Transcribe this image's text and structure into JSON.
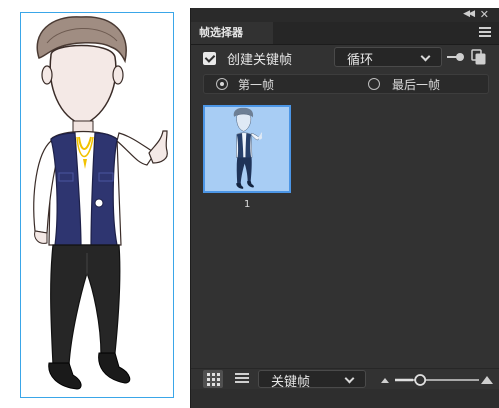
{
  "panel": {
    "title": "帧选择器",
    "collapse_icon": "double-chevron-right-icon",
    "close_icon": "close-icon",
    "menu_icon": "hamburger-menu-icon"
  },
  "toolbar": {
    "create_keyframe_label": "创建关键帧",
    "create_keyframe_checked": true,
    "loop_mode": "循环",
    "keyframe_nav_icon": "keyframe-dot-icon",
    "copy_icon": "copy-frames-icon"
  },
  "selection": {
    "first_frame_label": "第一帧",
    "last_frame_label": "最后一帧",
    "selected": "第一帧"
  },
  "frames": [
    {
      "number": "1",
      "selected": true
    }
  ],
  "bottom": {
    "grid_view_icon": "grid-view-icon",
    "list_view_icon": "list-view-icon",
    "display_mode": "关键帧",
    "zoom_small_icon": "mountain-small-icon",
    "zoom_large_icon": "mountain-large-icon",
    "zoom_level": 0.3
  },
  "colors": {
    "panel_bg": "#323232",
    "accent": "#4c96e6",
    "selection_frame": "#3aa6e8"
  }
}
